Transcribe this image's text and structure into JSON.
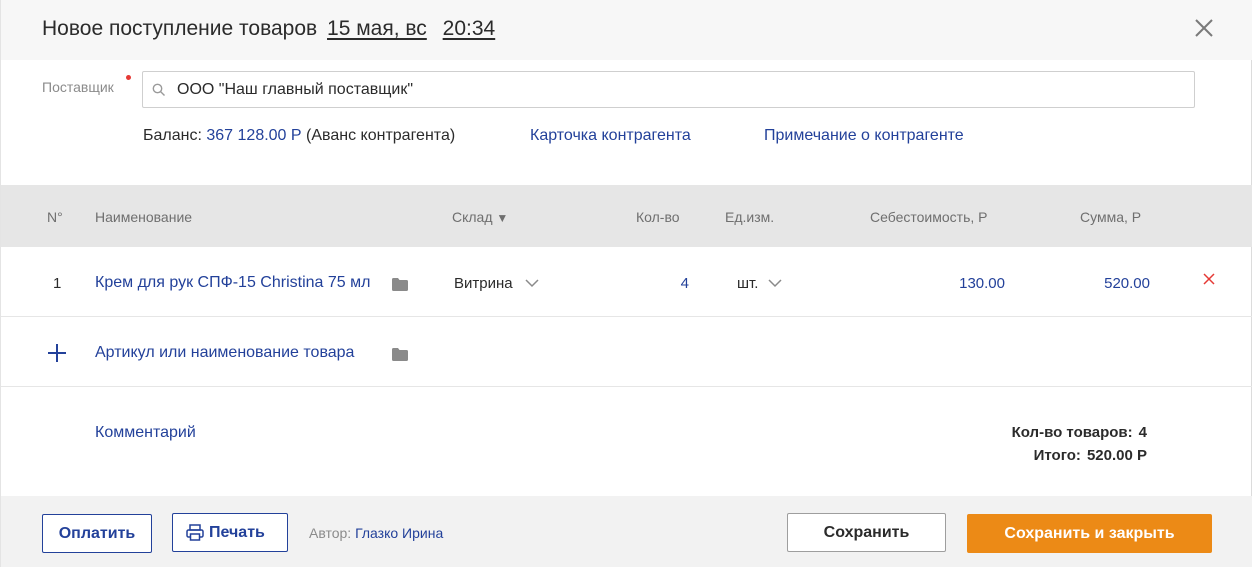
{
  "header": {
    "title": "Новое поступление товаров",
    "date": "15 мая, вс",
    "time": "20:34"
  },
  "supplier": {
    "label": "Поставщик",
    "value": "ООО \"Наш главный поставщик\"",
    "balance_label": "Баланс:",
    "balance_amount": "367 128.00 Р",
    "balance_note": "(Аванс контрагента)",
    "card_link": "Карточка контрагента",
    "note_link": "Примечание о контрагенте"
  },
  "table": {
    "columns": {
      "num": "N°",
      "name": "Наименование",
      "warehouse": "Склад",
      "warehouse_sort": "▼",
      "qty": "Кол-во",
      "unit": "Ед.изм.",
      "cost": "Себестоимость, Р",
      "sum": "Сумма, Р"
    },
    "rows": [
      {
        "num": "1",
        "name": "Крем для рук СПФ-15 Christina 75 мл",
        "warehouse": "Витрина",
        "qty": "4",
        "unit": "шт.",
        "cost": "130.00",
        "sum": "520.00"
      }
    ],
    "add_row_label": "Артикул или наименование товара"
  },
  "comment_label": "Комментарий",
  "totals": {
    "count_label": "Кол-во товаров:",
    "count_value": "4",
    "total_label": "Итого:",
    "total_value": "520.00 Р"
  },
  "footer": {
    "pay_label": "Оплатить",
    "print_label": "Печать",
    "author_label": "Автор:",
    "author_name": "Глазко Ирина",
    "save_label": "Сохранить",
    "save_close_label": "Сохранить и закрыть"
  },
  "colors": {
    "accent_blue": "#23419a",
    "orange": "#ec8a16",
    "delete_red": "#e53935",
    "header_bg": "#e6e6e6"
  },
  "icons": [
    "close-icon",
    "search-icon",
    "folder-icon",
    "chevron-down-icon",
    "delete-icon",
    "plus-icon",
    "printer-icon"
  ]
}
